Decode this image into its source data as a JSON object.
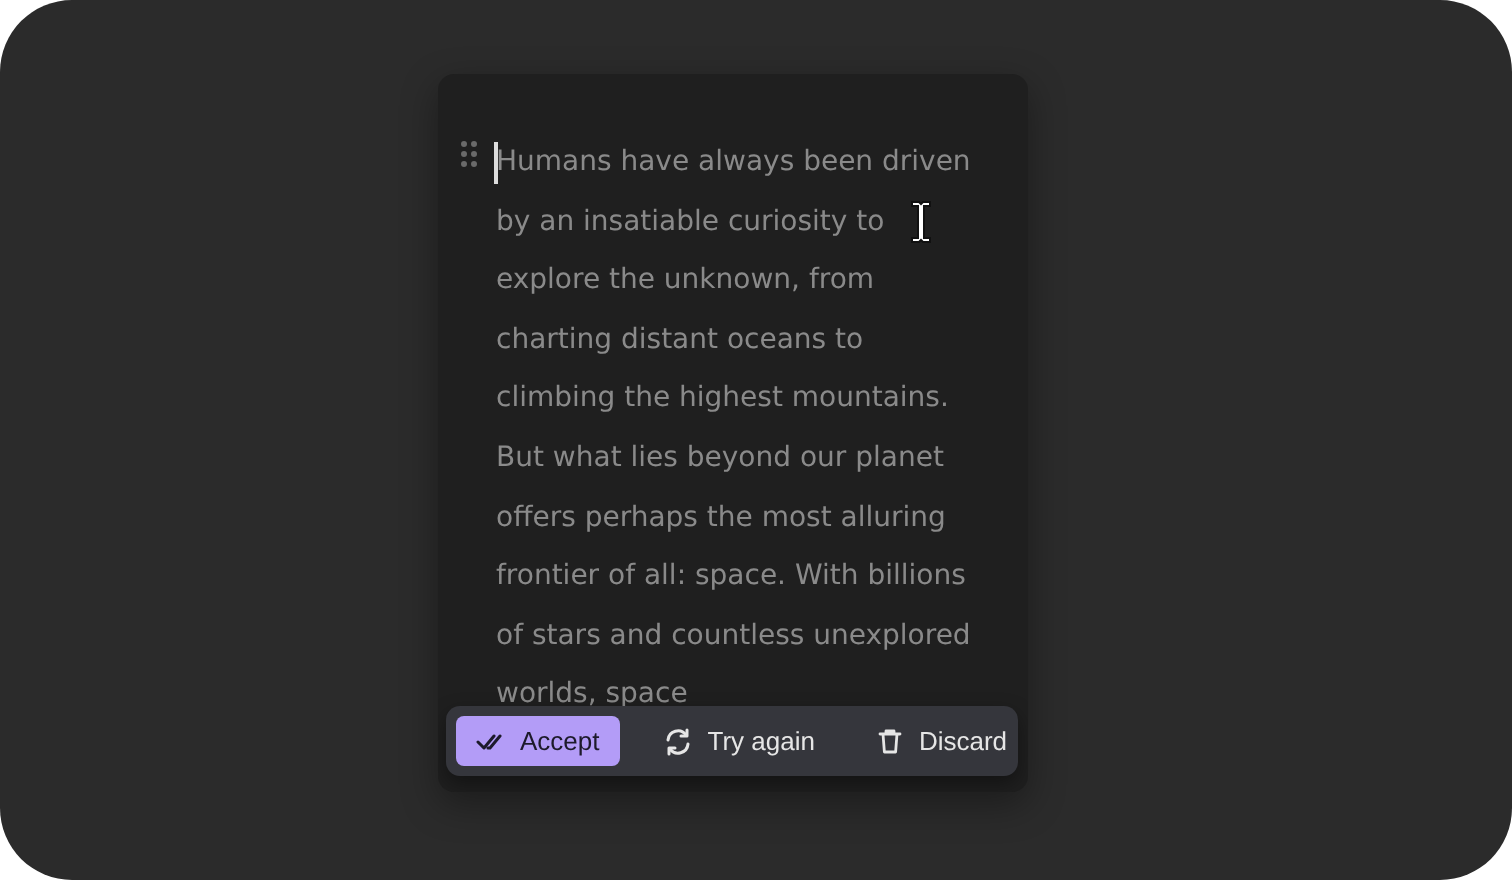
{
  "editor": {
    "text": "Humans have always been driven by an insatiable curiosity to explore the unknown, from charting distant oceans to climbing the highest mountains. But what lies beyond our planet offers perhaps the most alluring frontier of all: space. With billions of stars and countless unexplored worlds, space"
  },
  "actions": [
    {
      "label": "Accept",
      "kind": "accept",
      "selected": true
    },
    {
      "label": "Try again",
      "kind": "retry",
      "selected": false
    },
    {
      "label": "Discard",
      "kind": "discard",
      "selected": false
    }
  ]
}
